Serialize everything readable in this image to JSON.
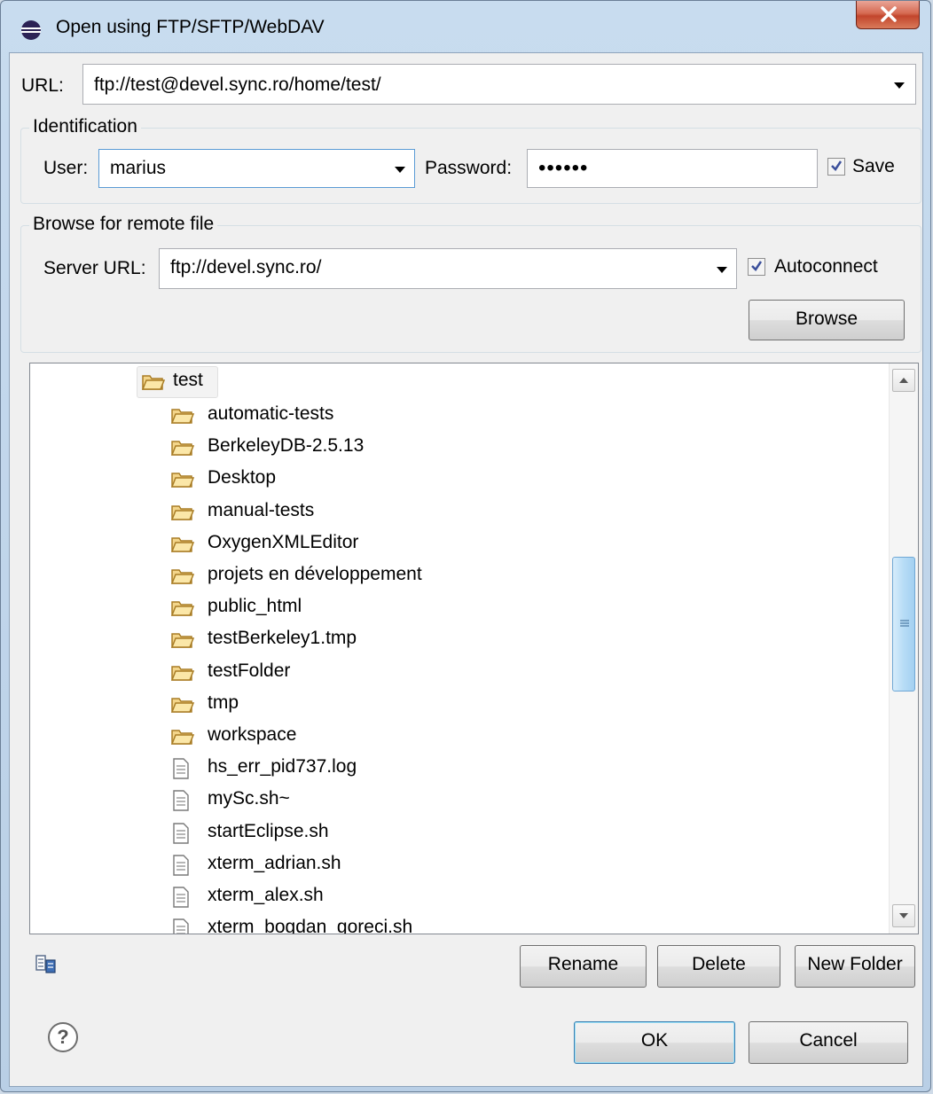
{
  "window": {
    "title": "Open using FTP/SFTP/WebDAV"
  },
  "url": {
    "label": "URL:",
    "value": "ftp://test@devel.sync.ro/home/test/"
  },
  "identification": {
    "title": "Identification",
    "user_label": "User:",
    "user_value": "marius",
    "password_label": "Password:",
    "password_value": "••••••",
    "save_label": "Save",
    "save_checked": true
  },
  "browse": {
    "title": "Browse for remote file",
    "server_label": "Server URL:",
    "server_value": "ftp://devel.sync.ro/",
    "autoconnect_label": "Autoconnect",
    "autoconnect_checked": true,
    "browse_button": "Browse"
  },
  "tree": {
    "root": "test",
    "items": [
      {
        "name": "automatic-tests",
        "type": "folder"
      },
      {
        "name": "BerkeleyDB-2.5.13",
        "type": "folder"
      },
      {
        "name": "Desktop",
        "type": "folder"
      },
      {
        "name": "manual-tests",
        "type": "folder"
      },
      {
        "name": "OxygenXMLEditor",
        "type": "folder"
      },
      {
        "name": "projets en développement",
        "type": "folder"
      },
      {
        "name": "public_html",
        "type": "folder"
      },
      {
        "name": "testBerkeley1.tmp",
        "type": "folder"
      },
      {
        "name": "testFolder",
        "type": "folder"
      },
      {
        "name": "tmp",
        "type": "folder"
      },
      {
        "name": "workspace",
        "type": "folder"
      },
      {
        "name": "hs_err_pid737.log",
        "type": "file"
      },
      {
        "name": "mySc.sh~",
        "type": "file"
      },
      {
        "name": "startEclipse.sh",
        "type": "file"
      },
      {
        "name": "xterm_adrian.sh",
        "type": "file"
      },
      {
        "name": "xterm_alex.sh",
        "type": "file"
      },
      {
        "name": "xterm_bogdan_goreci.sh",
        "type": "file"
      }
    ]
  },
  "actions": {
    "rename": "Rename",
    "delete": "Delete",
    "new_folder": "New Folder"
  },
  "footer": {
    "ok": "OK",
    "cancel": "Cancel"
  },
  "colors": {
    "accent": "#3c7fb1",
    "close_button": "#c2452c",
    "window_frame": "#c8dcef"
  },
  "icons": [
    "eclipse-icon",
    "close-icon",
    "folder-icon",
    "file-icon",
    "properties-icon",
    "help-icon"
  ]
}
